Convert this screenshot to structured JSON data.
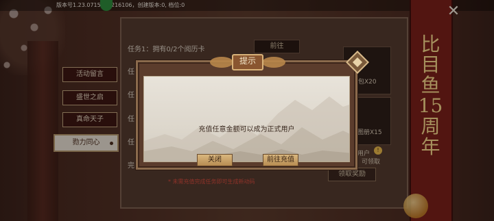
{
  "status_bar": {
    "version_text": "版本号1.23.0715.0.4216106，创建版本:0, 档位:0"
  },
  "side_tabs": [
    {
      "label": "活动留言"
    },
    {
      "label": "盛世之启"
    },
    {
      "label": "真命天子"
    },
    {
      "label": "勠力同心"
    }
  ],
  "tasks": {
    "task1": "任务1：拥有0/2个阅历卡",
    "go_label": "前往",
    "prefix_char": "任",
    "prefix_last": "完"
  },
  "rewards": {
    "item1_label": "包X20",
    "item2_label": "图册X15",
    "item3_line1": "用户",
    "item3_line2": "可领取",
    "claim_label": "领取奖励",
    "badge": "!"
  },
  "footer_hint": "* 未需充值完成任务即可生成新动码",
  "banner": {
    "text": "比目鱼15周年"
  },
  "dialog": {
    "title": "提示",
    "message": "充值任意金额可以成为正式用户",
    "close_label": "关闭",
    "recharge_label": "前往充值"
  }
}
